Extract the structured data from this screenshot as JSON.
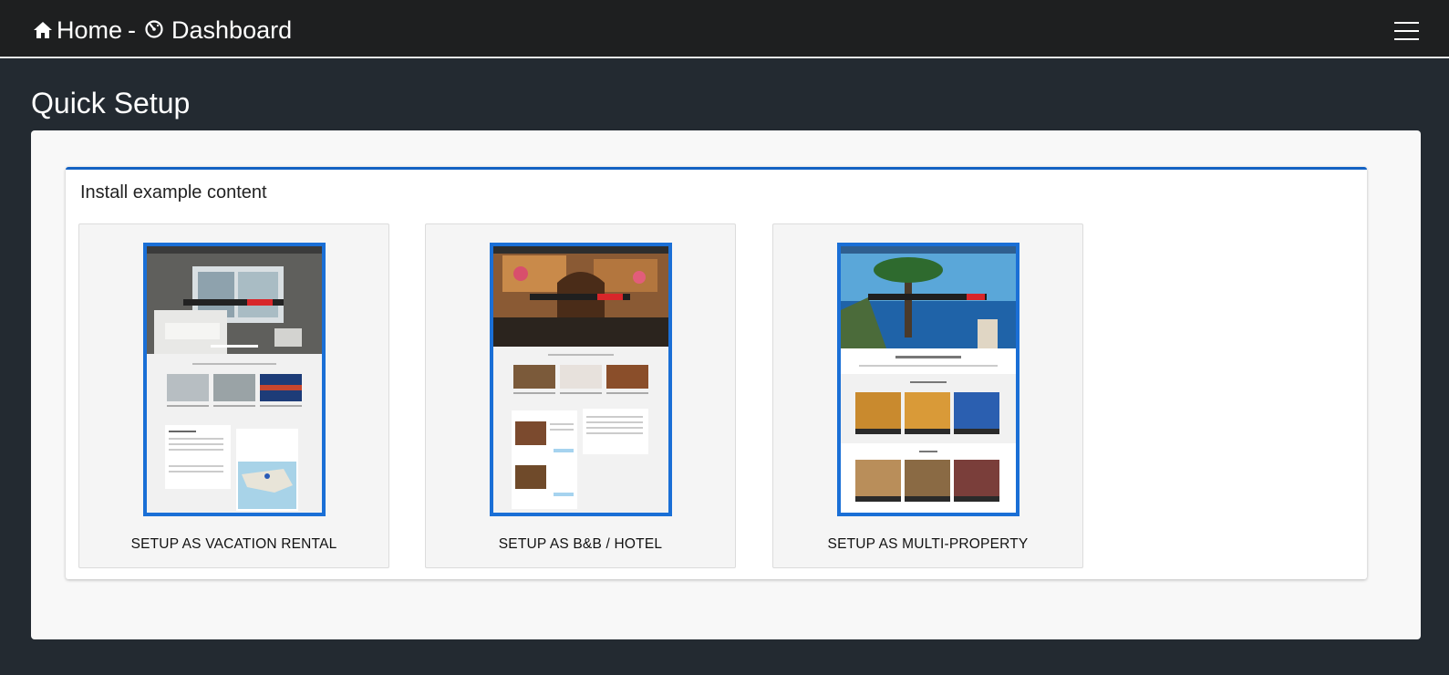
{
  "header": {
    "home_label": "Home",
    "separator": "-",
    "dashboard_label": "Dashboard"
  },
  "page": {
    "title": "Quick Setup"
  },
  "section": {
    "title": "Install example content",
    "options": [
      {
        "label": "SETUP AS VACATION RENTAL"
      },
      {
        "label": "SETUP AS B&B / HOTEL"
      },
      {
        "label": "SETUP AS MULTI-PROPERTY"
      }
    ]
  },
  "colors": {
    "accent": "#1a6fd6",
    "topbar": "#1e1f20",
    "background": "#232a31"
  }
}
